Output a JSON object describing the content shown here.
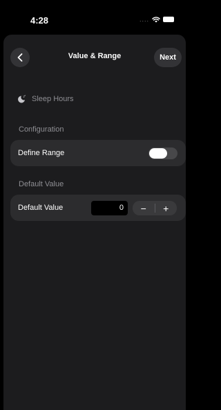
{
  "status_bar": {
    "time": "4:28",
    "signal": "...."
  },
  "nav": {
    "title": "Value & Range",
    "next_label": "Next"
  },
  "item": {
    "icon": "moon-zzz-icon",
    "label": "Sleep Hours"
  },
  "configuration": {
    "section_title": "Configuration",
    "define_range_label": "Define Range",
    "define_range_enabled": false
  },
  "default_value": {
    "section_title": "Default Value",
    "label": "Default Value",
    "value": "0",
    "minus_label": "−",
    "plus_label": "+"
  }
}
